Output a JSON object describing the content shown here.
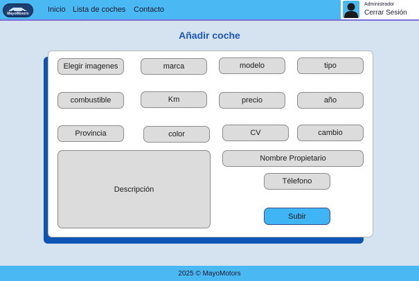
{
  "nav": {
    "logo_text": "MayoMotors",
    "links": [
      "Inicio",
      "Lista de coches",
      "Contacto"
    ],
    "user_role": "Administrador",
    "logout_label": "Cerrar Sesión"
  },
  "page": {
    "title": "Añadir coche"
  },
  "form": {
    "choose_images": "Elegir imagenes",
    "marca": "marca",
    "modelo": "modelo",
    "tipo": "tipo",
    "combustible": "combustible",
    "km": "Km",
    "precio": "precio",
    "anio": "año",
    "provincia": "Provincia",
    "color": "color",
    "cv": "CV",
    "cambio": "cambio",
    "descripcion": "Descripción",
    "nombre_propietario": "Nombre Propietario",
    "telefono": "Télefono",
    "submit": "Subir"
  },
  "footer": {
    "text": "2025 © MayoMotors"
  },
  "colors": {
    "navbar": "#4ab8f3",
    "background": "#d5e3f1",
    "title": "#1a56b5",
    "card_shadow": "#0e54b3",
    "submit": "#3fb5f5"
  }
}
